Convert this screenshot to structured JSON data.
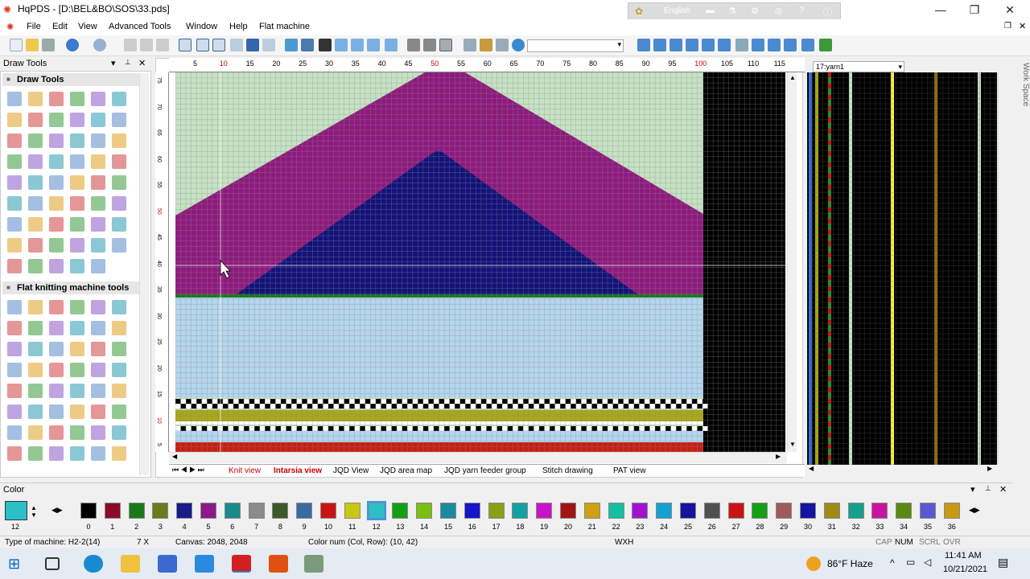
{
  "window": {
    "title": "HqPDS - [D:\\BEL&BO\\SOS\\33.pds]",
    "lang": "English",
    "controls": [
      "—",
      "❐",
      "✕"
    ]
  },
  "menu": [
    "File",
    "Edit",
    "View",
    "Advanced Tools",
    "Window",
    "Help",
    "Flat machine"
  ],
  "panel": {
    "title": "Draw Tools",
    "sec1": "Draw Tools",
    "sec2": "Flat knitting machine tools",
    "pin": "📌",
    "close": "✕",
    "menu_arrow": "▾"
  },
  "ruler": {
    "top": [
      "5",
      "10",
      "15",
      "20",
      "25",
      "30",
      "35",
      "40",
      "45",
      "50",
      "55",
      "60",
      "65",
      "70",
      "75",
      "80",
      "85",
      "90",
      "95",
      "100",
      "105",
      "110",
      "115"
    ],
    "left": [
      "75",
      "70",
      "65",
      "60",
      "55",
      "50",
      "45",
      "40",
      "35",
      "30",
      "25",
      "20",
      "15",
      "10",
      "5"
    ]
  },
  "yarn_select": "17:yarn1",
  "tabs": [
    "Knit view",
    "Intarsia view",
    "JQD View",
    "JQD area map",
    "JQD yarn feeder group",
    "Stitch drawing",
    "PAT view"
  ],
  "color_panel": {
    "title": "Color",
    "current": "12",
    "nums": [
      "0",
      "1",
      "2",
      "3",
      "4",
      "5",
      "6",
      "7",
      "8",
      "9",
      "10",
      "11",
      "12",
      "13",
      "14",
      "15",
      "16",
      "17",
      "18",
      "19",
      "20",
      "21",
      "22",
      "23",
      "24",
      "25",
      "26",
      "27",
      "28",
      "29",
      "30",
      "31",
      "32",
      "33",
      "34",
      "35",
      "36"
    ],
    "colors": [
      "#000000",
      "#8b0a2a",
      "#1a7a1a",
      "#6b7a1a",
      "#1a1a8b",
      "#8b1a8b",
      "#1a8b8b",
      "#8b8b8b",
      "#3a5a2a",
      "#3a6aa0",
      "#c81414",
      "#c8c814",
      "#2ac0c8",
      "#14a014",
      "#7ac014",
      "#1a8aa0",
      "#1414c8",
      "#8aa014",
      "#14a0a0",
      "#c814c8",
      "#a01414",
      "#d0a014",
      "#14c0a0",
      "#a014d0",
      "#14a0d0",
      "#1414a0",
      "#505050",
      "#c81414",
      "#14a014",
      "#a05a5a",
      "#1414a0",
      "#a08a14",
      "#14a08a",
      "#c814a0",
      "#5a8a14",
      "#5a5ad0",
      "#c89a14"
    ]
  },
  "status": {
    "machine": "Type of machine: H2-2(14)",
    "gauge": "7 X",
    "canvas": "Canvas: 2048, 2048",
    "colornum": "Color num  (Col, Row): (10, 42)",
    "wxh": "WXH",
    "cap": "CAP",
    "num": "NUM",
    "scrl": "SCRL",
    "ovr": "OVR"
  },
  "taskbar": {
    "weather": "86°F  Haze",
    "time": "11:41 AM",
    "date": "10/21/2021"
  },
  "workspace": "Work Space",
  "theme": {
    "magenta": "#8e1a7e",
    "navy": "#12127a",
    "grey": "#bdbdbd",
    "mint": "#c6e2c4",
    "sky": "#b4d6ee",
    "olive": "#a8a81a",
    "red": "#c81e14"
  }
}
